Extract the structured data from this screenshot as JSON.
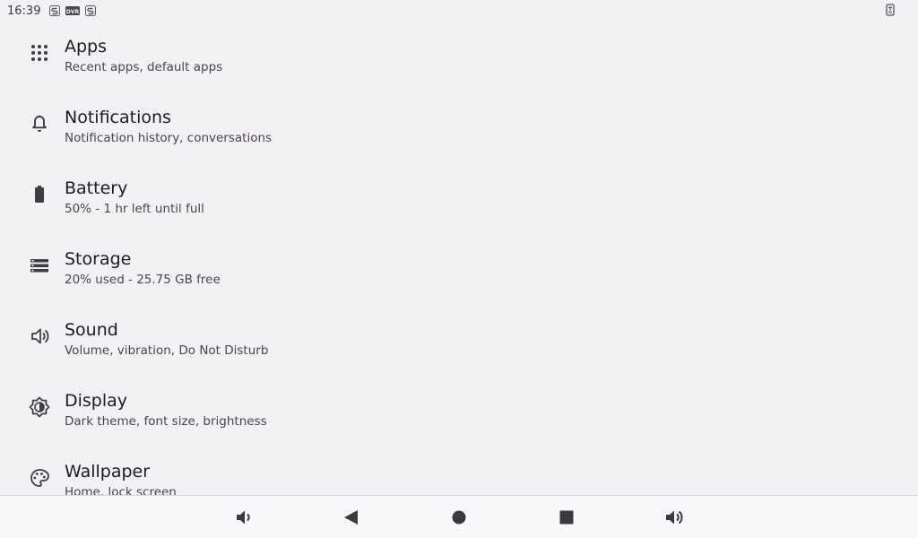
{
  "status_bar": {
    "time": "16:39",
    "left_icons": [
      "sync-icon",
      "dvr-icon",
      "sync-icon"
    ],
    "right_icon": "rotate-icon"
  },
  "settings": [
    {
      "title": "Apps",
      "summary": "Recent apps, default apps",
      "icon": "apps-grid-icon"
    },
    {
      "title": "Notifications",
      "summary": "Notification history, conversations",
      "icon": "bell-icon"
    },
    {
      "title": "Battery",
      "summary": "50% - 1 hr left until full",
      "icon": "battery-icon"
    },
    {
      "title": "Storage",
      "summary": "20% used - 25.75 GB free",
      "icon": "storage-icon"
    },
    {
      "title": "Sound",
      "summary": "Volume, vibration, Do Not Disturb",
      "icon": "speaker-icon"
    },
    {
      "title": "Display",
      "summary": "Dark theme, font size, brightness",
      "icon": "brightness-icon"
    },
    {
      "title": "Wallpaper",
      "summary": "Home, lock screen",
      "icon": "palette-icon"
    }
  ],
  "nav_bar": {
    "buttons": [
      "volume-down-icon",
      "back-icon",
      "home-icon",
      "overview-icon",
      "volume-up-icon"
    ]
  },
  "colors": {
    "background": "#f3f1f4",
    "text_primary": "#1d1b20",
    "text_secondary": "#49454f",
    "icon": "#3f3e44"
  }
}
